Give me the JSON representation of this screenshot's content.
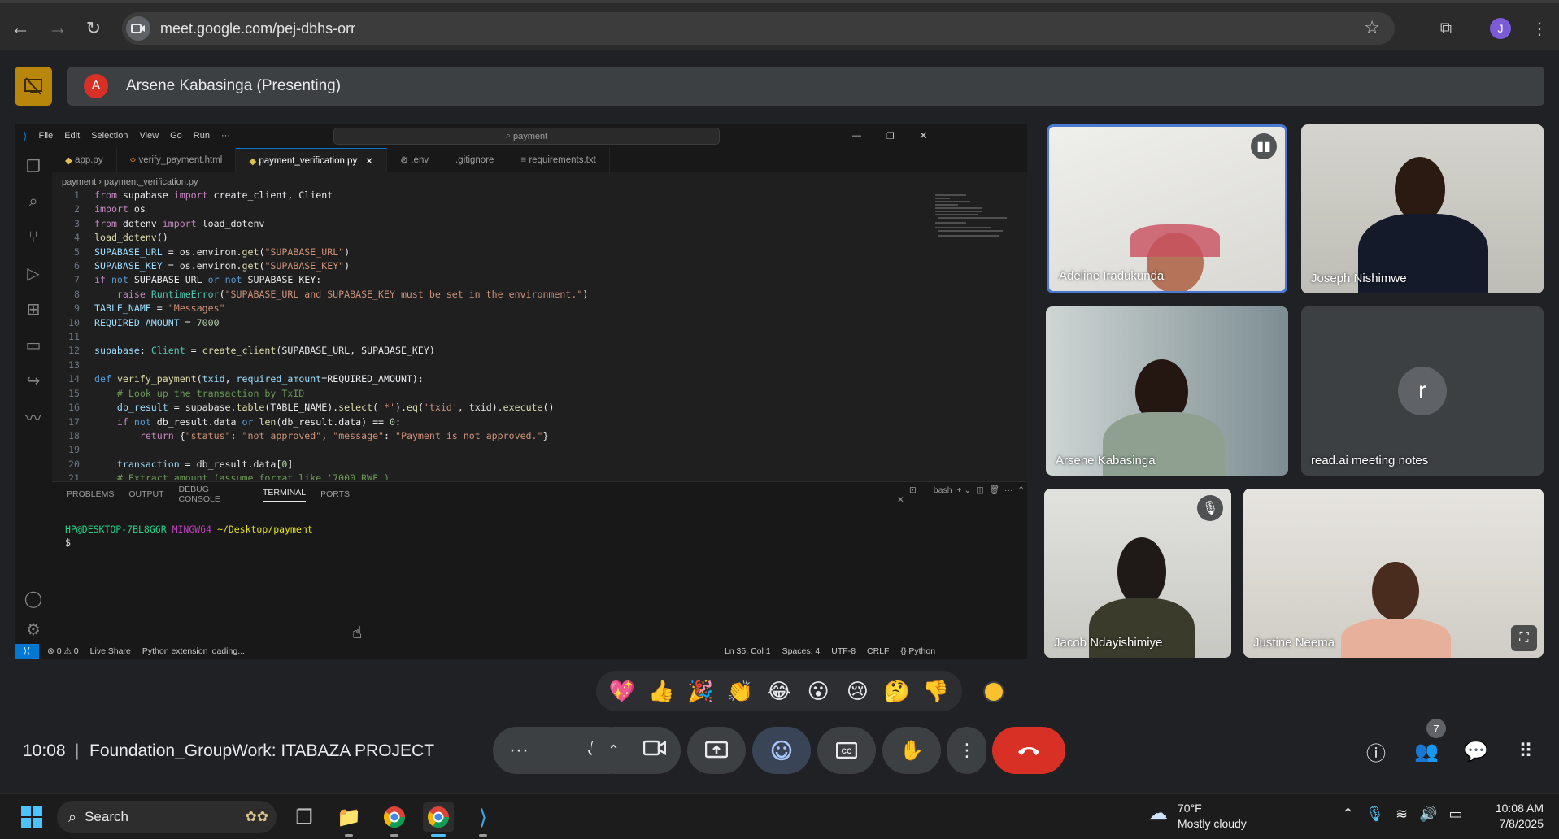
{
  "browser": {
    "url": "meet.google.com/pej-dbhs-orr",
    "profile_initial": "J"
  },
  "presenting": {
    "avatar_initial": "A",
    "text": "Arsene Kabasinga (Presenting)"
  },
  "vscode": {
    "menu": [
      "File",
      "Edit",
      "Selection",
      "View",
      "Go",
      "Run",
      "···"
    ],
    "search": "payment",
    "tabs": [
      {
        "label": "app.py",
        "active": false
      },
      {
        "label": "verify_payment.html",
        "active": false
      },
      {
        "label": "payment_verification.py",
        "active": true
      },
      {
        "label": ".env",
        "active": false
      },
      {
        "label": ".gitignore",
        "active": false
      },
      {
        "label": "requirements.txt",
        "active": false
      }
    ],
    "breadcrumb": "payment  ›  payment_verification.py",
    "panel_tabs": [
      "PROBLEMS",
      "OUTPUT",
      "DEBUG CONSOLE",
      "TERMINAL",
      "PORTS"
    ],
    "terminal_shell": "bash",
    "terminal_prompt_user": "HP@DESKTOP-7BL8G6R",
    "terminal_prompt_env": "MINGW64",
    "terminal_prompt_path": "~/Desktop/payment",
    "terminal_dollar": "$",
    "status_left": [
      "⊗ 0 ⚠ 0",
      "Live Share",
      "Python extension loading..."
    ],
    "status_right": [
      "Ln 35, Col 1",
      "Spaces: 4",
      "UTF-8",
      "CRLF",
      "{} Python"
    ]
  },
  "participants": [
    {
      "name": "Adeline Iradukunda",
      "speaking": true
    },
    {
      "name": "Joseph Nishimwe"
    },
    {
      "name": "Arsene Kabasinga"
    },
    {
      "name": "read.ai meeting notes",
      "initial": "r"
    },
    {
      "name": "Jacob Ndayishimiye",
      "muted": true
    },
    {
      "name": "Justine Neema"
    }
  ],
  "reactions": [
    "💖",
    "👍",
    "🎉",
    "👏",
    "😂",
    "😮",
    "😢",
    "🤔",
    "👎"
  ],
  "meeting": {
    "time": "10:08",
    "separator": "|",
    "name": "Foundation_GroupWork: ITABAZA PROJECT",
    "people_count": "7"
  },
  "taskbar": {
    "search": "Search",
    "weather_temp": "70°F",
    "weather_desc": "Mostly cloudy",
    "time": "10:08 AM",
    "date": "7/8/2025"
  },
  "colors": {
    "end_call": "#d93025",
    "presenting_icon": "#b8860b",
    "vscode_accent": "#0078d4"
  }
}
